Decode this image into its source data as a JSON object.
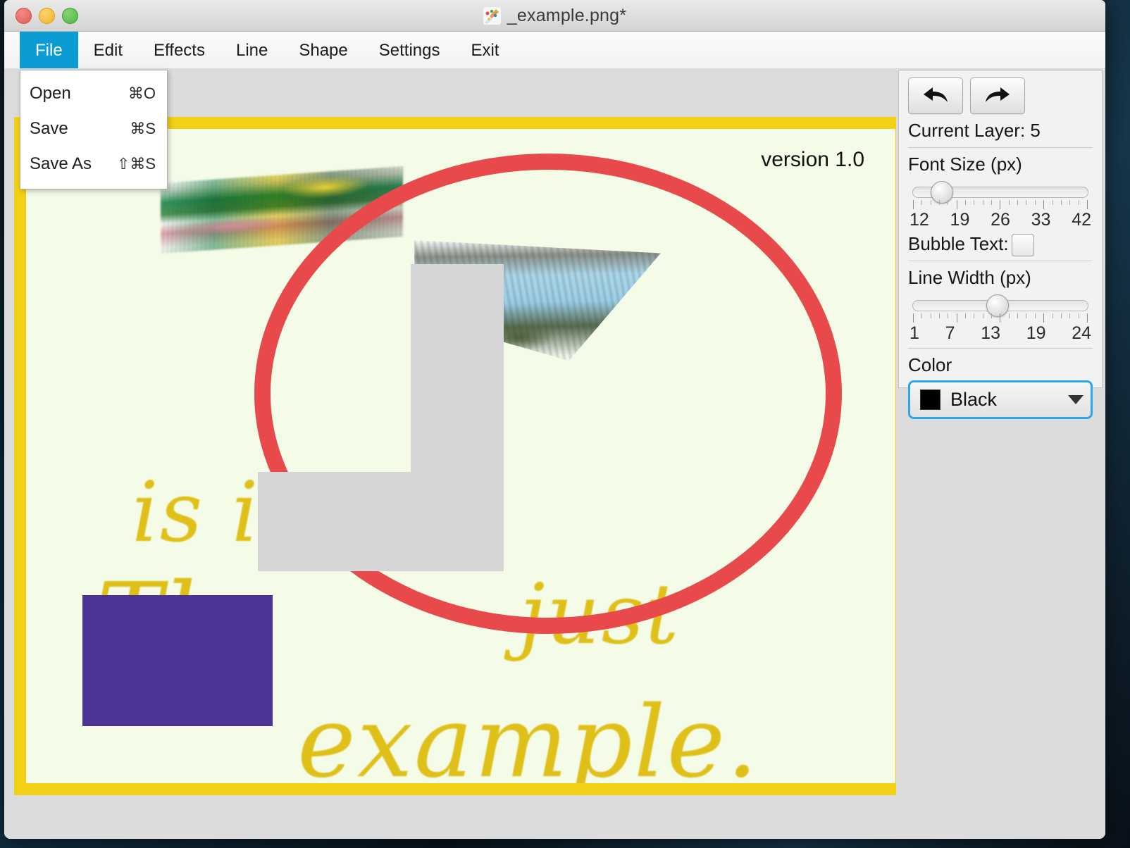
{
  "window": {
    "title": "_example.png*",
    "app_icon": "paint-brush-icon",
    "traffic_lights": [
      "close-button",
      "minimize-button",
      "zoom-button"
    ]
  },
  "menubar": {
    "items": [
      {
        "label": "File",
        "active": true
      },
      {
        "label": "Edit",
        "active": false
      },
      {
        "label": "Effects",
        "active": false
      },
      {
        "label": "Line",
        "active": false
      },
      {
        "label": "Shape",
        "active": false
      },
      {
        "label": "Settings",
        "active": false
      },
      {
        "label": "Exit",
        "active": false
      }
    ]
  },
  "file_menu": {
    "open": true,
    "items": [
      {
        "label": "Open",
        "shortcut": "⌘O"
      },
      {
        "label": "Save",
        "shortcut": "⌘S"
      },
      {
        "label": "Save As",
        "shortcut": "⇧⌘S"
      }
    ]
  },
  "panel": {
    "undo_label": "undo-arrow-icon",
    "redo_label": "redo-arrow-icon",
    "current_layer": "Current Layer: 5",
    "font_size": {
      "label": "Font Size (px)",
      "ticks": [
        "12",
        "19",
        "26",
        "33",
        "42"
      ],
      "min": 12,
      "max": 42,
      "value": 14
    },
    "bubble_text": {
      "label": "Bubble Text:",
      "checked": false
    },
    "line_width": {
      "label": "Line Width (px)",
      "ticks": [
        "1",
        "7",
        "13",
        "19",
        "24"
      ],
      "min": 1,
      "max": 24,
      "value": 11
    },
    "color": {
      "label": "Color",
      "selected": "Black",
      "swatch_hex": "#000000"
    }
  },
  "canvas": {
    "version_label": "version 1.0",
    "paper_bg_hex": "#F4FBE7",
    "border_hex": "#F2D013",
    "text_lines": [
      "is is",
      "Th",
      "just",
      "example."
    ],
    "text_color_hex": "#DFC018",
    "ellipse_color_hex": "#E84A4C",
    "rect_purple_hex": "#4E3396",
    "rect_gray_hex": "#D6D6D6"
  }
}
